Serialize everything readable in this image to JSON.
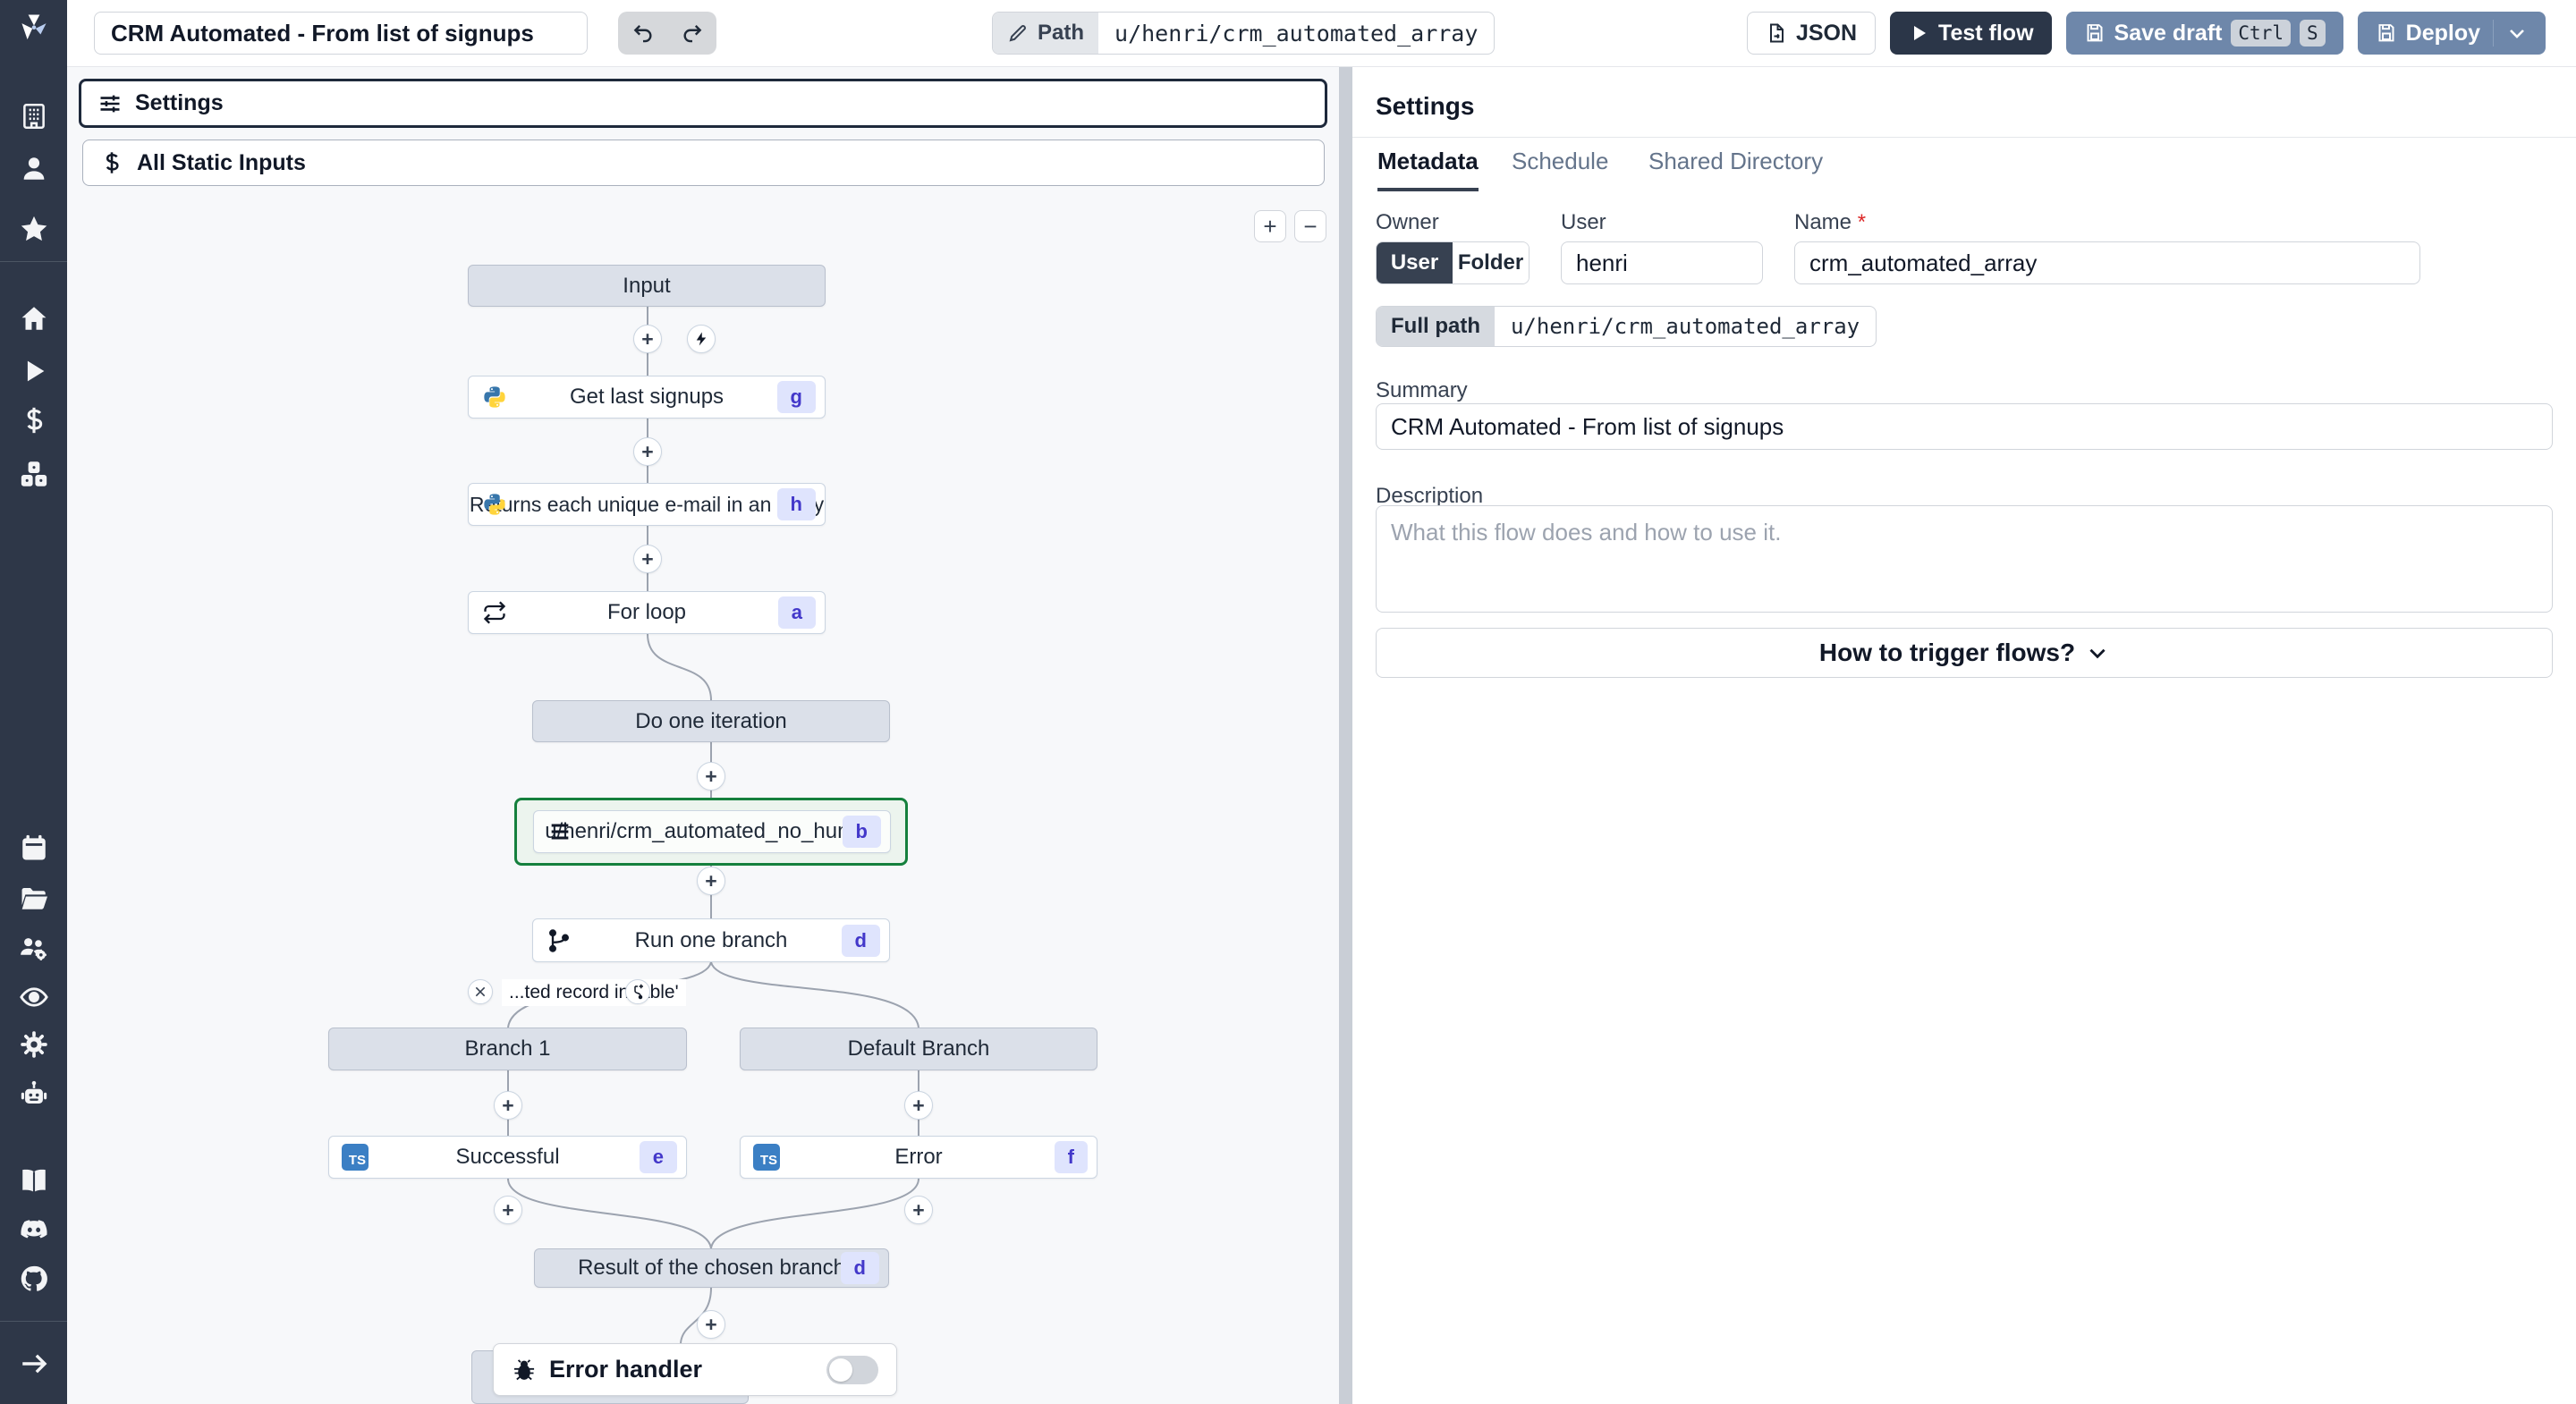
{
  "topbar": {
    "title_value": "CRM Automated - From list of signups",
    "path_label": "Path",
    "path_value": "u/henri/crm_automated_array",
    "json_button": "JSON",
    "test_flow_button": "Test flow",
    "save_draft_button": "Save draft",
    "kbd_ctrl": "Ctrl",
    "kbd_s": "S",
    "deploy_button": "Deploy"
  },
  "flow_panel": {
    "settings_box": "Settings",
    "static_inputs_box": "All Static Inputs",
    "zoom_in": "+",
    "zoom_out": "−",
    "condition_label": "...ted record in table'",
    "error_handler_label": "Error handler",
    "nodes": [
      {
        "label": "Input",
        "badge": ""
      },
      {
        "label": "Get last signups",
        "badge": "g"
      },
      {
        "label": "Returns each unique e-mail in an array",
        "badge": "h"
      },
      {
        "label": "For loop",
        "badge": "a"
      },
      {
        "label": "Do one iteration",
        "badge": ""
      },
      {
        "label": "u/henri/crm_automated_no_human",
        "badge": "b"
      },
      {
        "label": "Run one branch",
        "badge": "d"
      },
      {
        "label": "Branch 1",
        "badge": ""
      },
      {
        "label": "Default Branch",
        "badge": ""
      },
      {
        "label": "Successful",
        "badge": "e"
      },
      {
        "label": "Error",
        "badge": "f"
      },
      {
        "label": "Result of the chosen branch",
        "badge": "d"
      }
    ],
    "ts_icon_text": "TS"
  },
  "settings_panel": {
    "title": "Settings",
    "tabs": [
      "Metadata",
      "Schedule",
      "Shared Directory"
    ],
    "owner_label": "Owner",
    "owner_user": "User",
    "owner_folder": "Folder",
    "user_label": "User",
    "user_value": "henri",
    "name_label": "Name",
    "name_required": "*",
    "name_value": "crm_automated_array",
    "full_path_label": "Full path",
    "full_path_value": "u/henri/crm_automated_array",
    "summary_label": "Summary",
    "summary_value": "CRM Automated - From list of signups",
    "description_label": "Description",
    "description_placeholder": "What this flow does and how to use it.",
    "trigger_button": "How to trigger flows?"
  },
  "colors": {
    "sidebar_bg": "#2e3748",
    "accent_dark": "#2b3648",
    "accent_slate": "#6e87aa",
    "badge_bg": "#dfe4fd",
    "badge_text": "#4338ca",
    "selected_green": "#15803d",
    "node_gray": "#dbe0e9",
    "canvas_bg": "#f7f8fa",
    "ts_blue": "#3b7fc4"
  }
}
